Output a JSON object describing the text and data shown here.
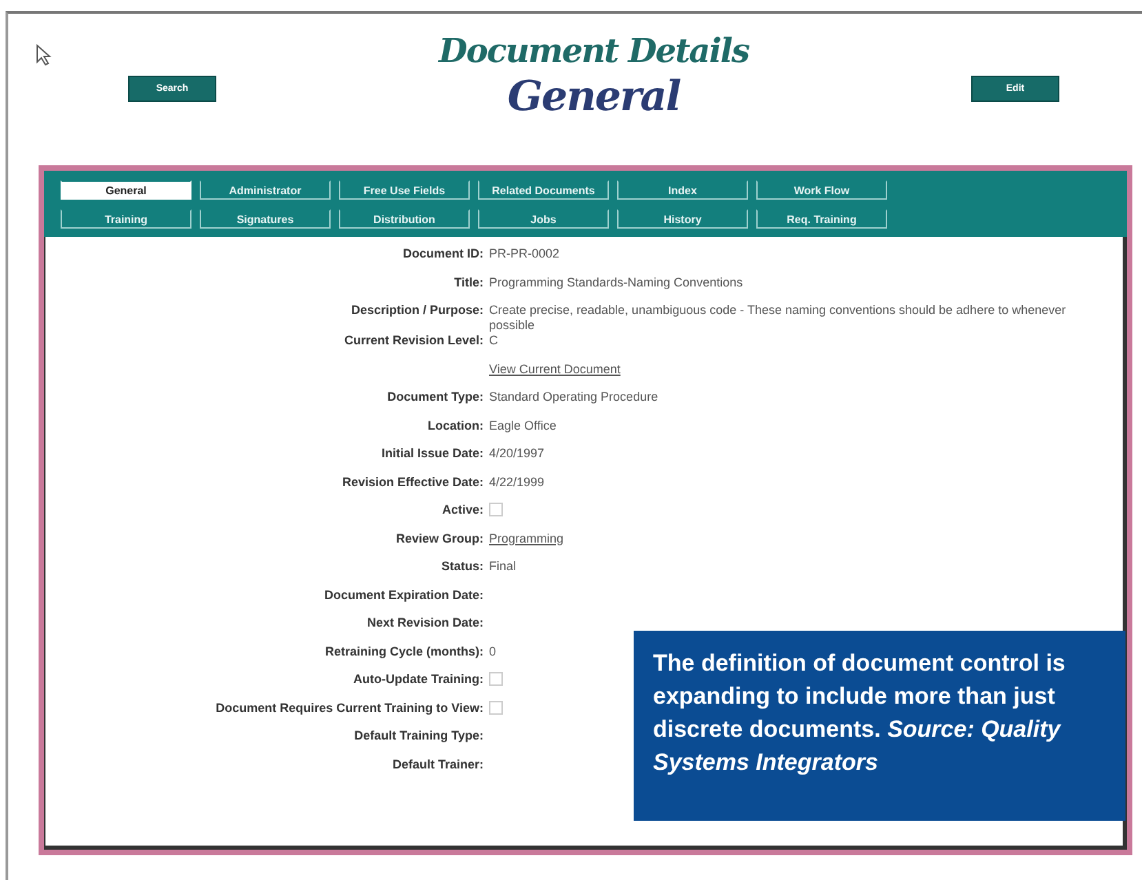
{
  "header": {
    "title": "Document Details",
    "subtitle": "General",
    "buttons": [
      {
        "label": "Search"
      },
      {
        "label": "Edit"
      }
    ]
  },
  "tabs": [
    [
      {
        "label": "General",
        "selected": true
      },
      {
        "label": "Administrator",
        "selected": false
      },
      {
        "label": "Free Use Fields",
        "selected": false
      },
      {
        "label": "Related Documents",
        "selected": false
      },
      {
        "label": "Index",
        "selected": false
      },
      {
        "label": "Work Flow",
        "selected": false
      }
    ],
    [
      {
        "label": "Training",
        "selected": false
      },
      {
        "label": "Signatures",
        "selected": false
      },
      {
        "label": "Distribution",
        "selected": false
      },
      {
        "label": "Jobs",
        "selected": false
      },
      {
        "label": "History",
        "selected": false
      },
      {
        "label": "Req. Training",
        "selected": false
      }
    ]
  ],
  "fields": [
    {
      "kind": "text",
      "label": "Document ID:",
      "value": "PR-PR-0002"
    },
    {
      "kind": "text",
      "label": "Title:",
      "value": "Programming Standards-Naming Conventions"
    },
    {
      "kind": "text",
      "label": "Description / Purpose:",
      "value": "Create precise, readable, unambiguous code - These naming conventions should be adhere to whenever possible"
    },
    {
      "kind": "text",
      "label": "Current Revision Level:",
      "value": "C"
    },
    {
      "kind": "link",
      "value": "View Current Document"
    },
    {
      "kind": "text",
      "label": "Document Type:",
      "value": "Standard Operating Procedure"
    },
    {
      "kind": "text",
      "label": "Location:",
      "value": "Eagle Office"
    },
    {
      "kind": "text",
      "label": "Initial Issue Date:",
      "value": "4/20/1997"
    },
    {
      "kind": "text",
      "label": "Revision Effective Date:",
      "value": "4/22/1999"
    },
    {
      "kind": "checkbox",
      "label": "Active:",
      "checked": false
    },
    {
      "kind": "link",
      "label": "Review Group:",
      "value": "Programming"
    },
    {
      "kind": "text",
      "label": "Status:",
      "value": "Final"
    },
    {
      "kind": "text",
      "label": "Document Expiration Date:"
    },
    {
      "kind": "text",
      "label": "Next Revision Date:"
    },
    {
      "kind": "text",
      "label": "Retraining Cycle (months):",
      "value": "0"
    },
    {
      "kind": "checkbox",
      "label": "Auto-Update Training:",
      "checked": false
    },
    {
      "kind": "checkbox",
      "label": "Document Requires Current Training to View:",
      "checked": false
    },
    {
      "kind": "text",
      "label": "Default Training Type:"
    },
    {
      "kind": "text",
      "label": "Default Trainer:"
    }
  ],
  "caption": {
    "text": "The definition of document control is expanding to include more than just discrete documents. *Source: Quality Systems Integrators*"
  }
}
